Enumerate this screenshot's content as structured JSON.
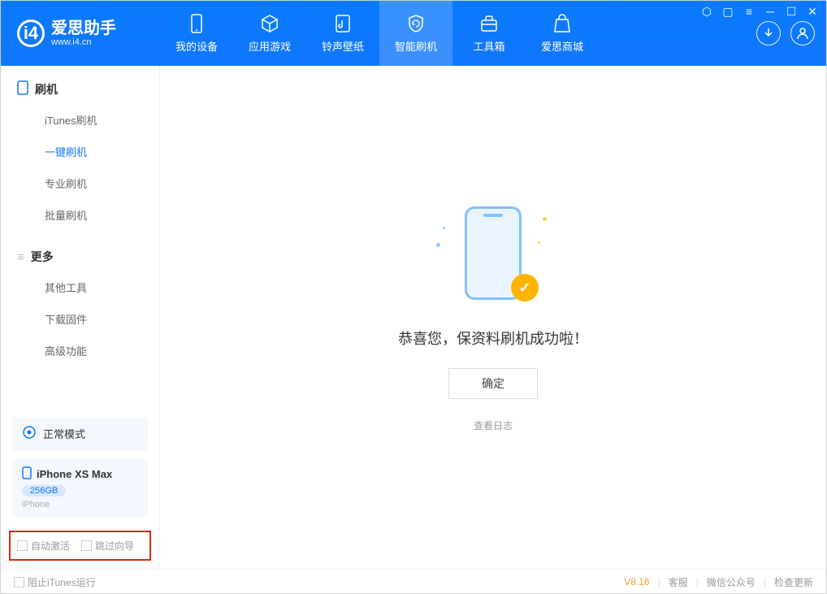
{
  "app": {
    "title": "爱思助手",
    "url": "www.i4.cn"
  },
  "nav": {
    "tabs": [
      {
        "label": "我的设备"
      },
      {
        "label": "应用游戏"
      },
      {
        "label": "铃声壁纸"
      },
      {
        "label": "智能刷机"
      },
      {
        "label": "工具箱"
      },
      {
        "label": "爱思商城"
      }
    ]
  },
  "sidebar": {
    "section1": {
      "header": "刷机",
      "items": [
        "iTunes刷机",
        "一键刷机",
        "专业刷机",
        "批量刷机"
      ]
    },
    "section2": {
      "header": "更多",
      "items": [
        "其他工具",
        "下载固件",
        "高级功能"
      ]
    },
    "mode_label": "正常模式",
    "device": {
      "name": "iPhone XS Max",
      "storage": "256GB",
      "type": "iPhone"
    },
    "check1": "自动激活",
    "check2": "跳过向导"
  },
  "main": {
    "message": "恭喜您，保资料刷机成功啦！",
    "ok": "确定",
    "view_log": "查看日志"
  },
  "footer": {
    "block_itunes": "阻止iTunes运行",
    "version": "V8.16",
    "links": [
      "客服",
      "微信公众号",
      "检查更新"
    ]
  }
}
